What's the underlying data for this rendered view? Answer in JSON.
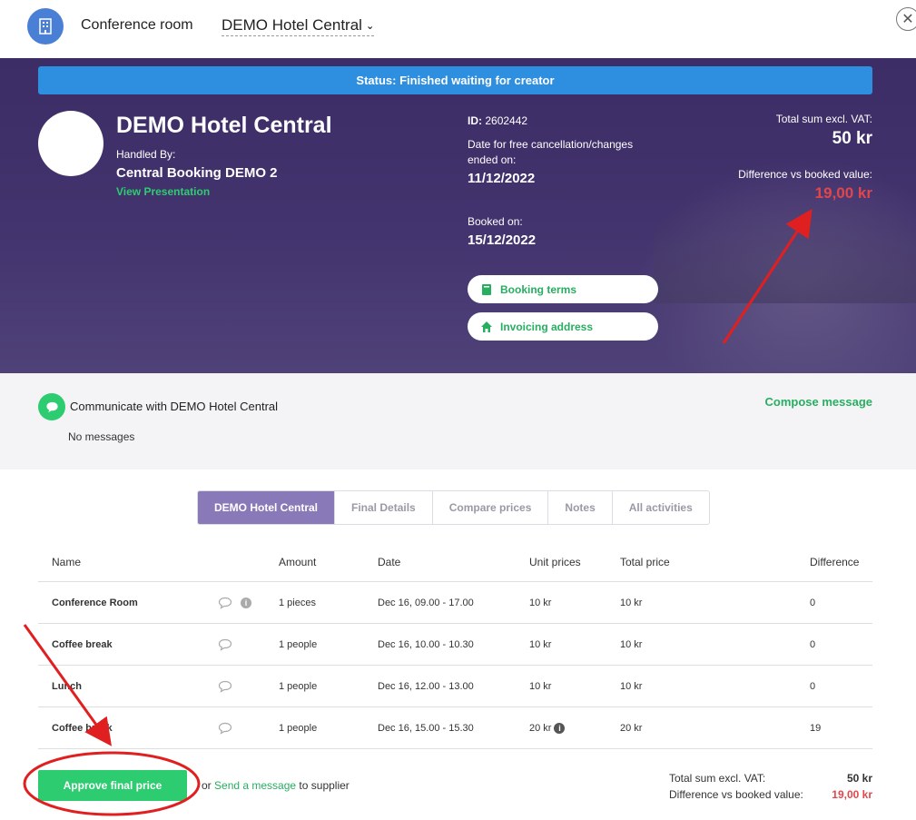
{
  "header": {
    "label": "Conference room",
    "selected_hotel": "DEMO Hotel Central"
  },
  "status": {
    "text": "Status: Finished waiting for creator",
    "color": "#2e8fe0"
  },
  "hotel": {
    "name": "DEMO Hotel Central",
    "handled_by_label": "Handled By:",
    "handler": "Central Booking DEMO 2",
    "view_presentation": "View Presentation"
  },
  "booking": {
    "id_label": "ID:",
    "id_value": "2602442",
    "cancel_label": "Date for free cancellation/changes ended on:",
    "cancel_date": "11/12/2022",
    "booked_label": "Booked on:",
    "booked_date": "15/12/2022",
    "terms_button": "Booking terms",
    "invoice_button": "Invoicing address",
    "total_label": "Total sum excl. VAT:",
    "total_value": "50 kr",
    "diff_label": "Difference vs booked value:",
    "diff_value": "19,00 kr"
  },
  "communication": {
    "title": "Communicate with DEMO Hotel Central",
    "empty": "No messages",
    "compose": "Compose message"
  },
  "tabs": [
    {
      "label": "DEMO Hotel Central",
      "active": true
    },
    {
      "label": "Final Details",
      "active": false
    },
    {
      "label": "Compare prices",
      "active": false
    },
    {
      "label": "Notes",
      "active": false
    },
    {
      "label": "All activities",
      "active": false
    }
  ],
  "table": {
    "headers": {
      "name": "Name",
      "amount": "Amount",
      "date": "Date",
      "unit": "Unit prices",
      "total": "Total price",
      "diff": "Difference"
    },
    "rows": [
      {
        "name": "Conference Room",
        "amount": "1 pieces",
        "date": "Dec 16, 09.00 - 17.00",
        "unit": "10 kr",
        "total": "10 kr",
        "diff": "0"
      },
      {
        "name": "Coffee break",
        "amount": "1 people",
        "date": "Dec 16, 10.00 - 10.30",
        "unit": "10 kr",
        "total": "10 kr",
        "diff": "0"
      },
      {
        "name": "Lunch",
        "amount": "1 people",
        "date": "Dec 16, 12.00 - 13.00",
        "unit": "10 kr",
        "total": "10 kr",
        "diff": "0"
      },
      {
        "name": "Coffee break",
        "amount": "1 people",
        "date": "Dec 16, 15.00 - 15.30",
        "unit": "20 kr",
        "total": "20 kr",
        "diff": "19"
      }
    ]
  },
  "footer": {
    "approve": "Approve final price",
    "or": "or",
    "send_link": "Send a message",
    "send_suffix": "to supplier",
    "total_label": "Total sum excl. VAT:",
    "total_value": "50 kr",
    "diff_label": "Difference vs booked value:",
    "diff_value": "19,00 kr"
  },
  "colors": {
    "accent_green": "#2ecc71",
    "tab_active": "#8a79b8",
    "danger": "#e0474c",
    "hero": "#3d2d66"
  }
}
